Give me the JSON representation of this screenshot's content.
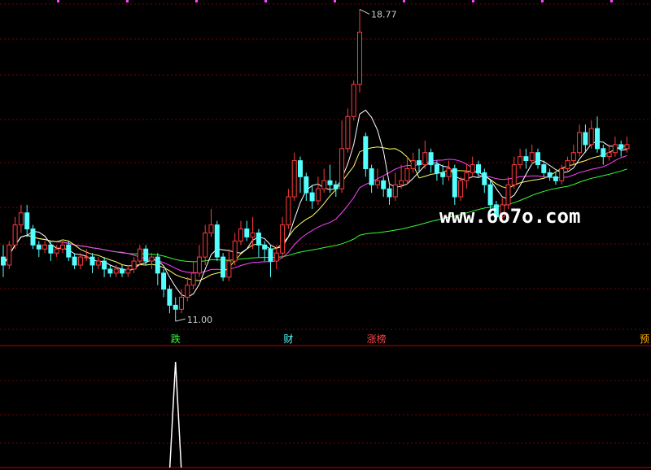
{
  "chart_data": {
    "type": "candlestick",
    "price_range": [
      10.8,
      18.9
    ],
    "high_label": "18.77",
    "low_label": "11.00",
    "up_color": "#ff3b3b",
    "down_color": "#54ffff",
    "ma_colors": {
      "ma5": "#ffffff",
      "ma10": "#ffff66",
      "ma20": "#ff44ff",
      "ma60": "#33ff33"
    },
    "candles": [
      [
        12.6,
        12.4,
        12.9,
        12.1
      ],
      [
        12.4,
        12.9,
        13.0,
        12.3
      ],
      [
        12.9,
        13.4,
        13.6,
        12.8
      ],
      [
        13.4,
        13.7,
        13.9,
        13.2
      ],
      [
        13.7,
        13.3,
        13.9,
        13.1
      ],
      [
        13.3,
        12.9,
        13.4,
        12.8
      ],
      [
        12.9,
        12.8,
        13.0,
        12.6
      ],
      [
        12.8,
        12.9,
        13.0,
        12.7
      ],
      [
        12.9,
        12.7,
        13.0,
        12.5
      ],
      [
        12.7,
        12.8,
        12.9,
        12.6
      ],
      [
        12.8,
        12.9,
        13.0,
        12.7
      ],
      [
        12.9,
        12.6,
        13.0,
        12.5
      ],
      [
        12.6,
        12.4,
        12.7,
        12.3
      ],
      [
        12.4,
        12.6,
        12.7,
        12.3
      ],
      [
        12.6,
        12.6,
        12.8,
        12.5
      ],
      [
        12.6,
        12.4,
        12.7,
        12.2
      ],
      [
        12.4,
        12.5,
        12.6,
        12.3
      ],
      [
        12.5,
        12.3,
        12.6,
        12.1
      ],
      [
        12.3,
        12.2,
        12.4,
        12.1
      ],
      [
        12.2,
        12.3,
        12.4,
        12.1
      ],
      [
        12.3,
        12.2,
        12.4,
        12.1
      ],
      [
        12.2,
        12.3,
        12.4,
        12.1
      ],
      [
        12.3,
        12.5,
        12.6,
        12.2
      ],
      [
        12.5,
        12.8,
        12.9,
        12.4
      ],
      [
        12.8,
        12.5,
        12.9,
        12.4
      ],
      [
        12.5,
        12.6,
        12.7,
        12.3
      ],
      [
        12.6,
        12.2,
        12.7,
        11.9
      ],
      [
        12.2,
        11.8,
        12.3,
        11.6
      ],
      [
        11.8,
        11.4,
        11.9,
        11.2
      ],
      [
        11.4,
        11.3,
        11.6,
        11.0
      ],
      [
        11.3,
        11.6,
        11.8,
        11.2
      ],
      [
        11.6,
        11.9,
        12.1,
        11.5
      ],
      [
        11.9,
        12.2,
        12.5,
        11.8
      ],
      [
        12.2,
        12.6,
        12.9,
        12.1
      ],
      [
        12.6,
        13.2,
        13.4,
        12.4
      ],
      [
        13.2,
        13.4,
        13.8,
        13.1
      ],
      [
        13.4,
        12.6,
        13.5,
        12.5
      ],
      [
        12.6,
        12.1,
        12.7,
        12.0
      ],
      [
        12.1,
        12.5,
        12.8,
        12.0
      ],
      [
        12.5,
        13.0,
        13.2,
        12.4
      ],
      [
        13.0,
        13.3,
        13.5,
        12.9
      ],
      [
        13.3,
        13.1,
        13.5,
        13.0
      ],
      [
        13.1,
        13.2,
        13.6,
        12.8
      ],
      [
        13.2,
        12.9,
        13.3,
        12.6
      ],
      [
        12.9,
        12.8,
        13.0,
        12.5
      ],
      [
        12.8,
        12.5,
        12.9,
        12.1
      ],
      [
        12.5,
        12.7,
        12.9,
        12.3
      ],
      [
        12.7,
        13.4,
        13.6,
        12.6
      ],
      [
        13.4,
        14.1,
        14.3,
        13.3
      ],
      [
        14.1,
        15.0,
        15.2,
        14.0
      ],
      [
        15.0,
        14.6,
        15.1,
        14.2
      ],
      [
        14.6,
        14.2,
        14.7,
        14.0
      ],
      [
        14.2,
        14.0,
        14.4,
        13.8
      ],
      [
        14.0,
        14.3,
        14.6,
        13.9
      ],
      [
        14.3,
        14.5,
        14.8,
        14.2
      ],
      [
        14.5,
        14.4,
        14.9,
        14.2
      ],
      [
        14.4,
        14.3,
        14.5,
        14.1
      ],
      [
        14.3,
        15.3,
        16.0,
        14.2
      ],
      [
        15.3,
        16.1,
        16.3,
        15.2
      ],
      [
        16.1,
        16.9,
        17.0,
        16.0
      ],
      [
        16.9,
        18.2,
        18.77,
        16.7
      ],
      [
        15.6,
        14.8,
        15.7,
        14.6
      ],
      [
        14.8,
        14.4,
        14.9,
        14.2
      ],
      [
        14.4,
        14.5,
        14.8,
        14.3
      ],
      [
        14.5,
        14.3,
        14.6,
        14.1
      ],
      [
        14.3,
        14.1,
        14.4,
        13.9
      ],
      [
        14.1,
        14.4,
        14.7,
        14.0
      ],
      [
        14.4,
        14.5,
        14.9,
        14.3
      ],
      [
        14.5,
        14.8,
        15.1,
        14.4
      ],
      [
        14.8,
        15.0,
        15.2,
        14.7
      ],
      [
        15.0,
        14.9,
        15.3,
        14.7
      ],
      [
        14.9,
        15.2,
        15.5,
        14.8
      ],
      [
        15.2,
        14.9,
        15.3,
        14.7
      ],
      [
        14.9,
        14.7,
        15.0,
        14.5
      ],
      [
        14.7,
        14.6,
        14.9,
        14.4
      ],
      [
        14.6,
        14.8,
        15.0,
        14.5
      ],
      [
        14.8,
        14.1,
        14.9,
        13.9
      ],
      [
        14.1,
        14.5,
        14.6,
        14.0
      ],
      [
        14.5,
        14.7,
        14.9,
        14.3
      ],
      [
        14.7,
        14.9,
        15.1,
        14.6
      ],
      [
        14.9,
        14.7,
        15.0,
        14.6
      ],
      [
        14.7,
        14.4,
        14.8,
        14.2
      ],
      [
        14.4,
        13.9,
        14.5,
        13.7
      ],
      [
        13.9,
        13.6,
        14.0,
        13.5
      ],
      [
        13.6,
        13.9,
        14.1,
        13.5
      ],
      [
        13.9,
        14.4,
        14.6,
        13.8
      ],
      [
        14.4,
        14.9,
        15.1,
        14.3
      ],
      [
        14.9,
        15.1,
        15.3,
        14.8
      ],
      [
        15.1,
        15.0,
        15.3,
        14.8
      ],
      [
        15.0,
        15.2,
        15.4,
        14.9
      ],
      [
        15.2,
        14.9,
        15.3,
        14.8
      ],
      [
        14.9,
        14.7,
        15.0,
        14.6
      ],
      [
        14.7,
        14.6,
        14.8,
        14.5
      ],
      [
        14.6,
        14.5,
        14.7,
        14.4
      ],
      [
        14.5,
        14.8,
        14.9,
        14.4
      ],
      [
        14.8,
        15.0,
        15.1,
        14.7
      ],
      [
        15.0,
        15.2,
        15.4,
        14.9
      ],
      [
        15.2,
        15.7,
        15.9,
        15.1
      ],
      [
        15.7,
        15.4,
        15.9,
        15.2
      ],
      [
        15.4,
        15.8,
        16.0,
        15.3
      ],
      [
        15.8,
        15.3,
        16.1,
        15.2
      ],
      [
        15.3,
        15.1,
        15.4,
        14.9
      ],
      [
        15.1,
        15.2,
        15.4,
        15.0
      ],
      [
        15.2,
        15.4,
        15.6,
        15.1
      ],
      [
        15.4,
        15.3,
        15.5,
        15.1
      ],
      [
        15.3,
        15.4,
        15.6,
        15.2
      ]
    ],
    "markers": [
      {
        "label": "跌",
        "index": 29,
        "color": "#33ff33"
      },
      {
        "label": "财",
        "index": 48,
        "color": "#54ffff"
      },
      {
        "label": "涨榜",
        "index": 62,
        "color": "#ff4444"
      },
      {
        "label": "预",
        "index": 109,
        "color": "#ffaa00"
      }
    ],
    "indicator": {
      "spike_index": 29,
      "color": "#ffffff"
    }
  },
  "watermark": "www.6o7o.com"
}
